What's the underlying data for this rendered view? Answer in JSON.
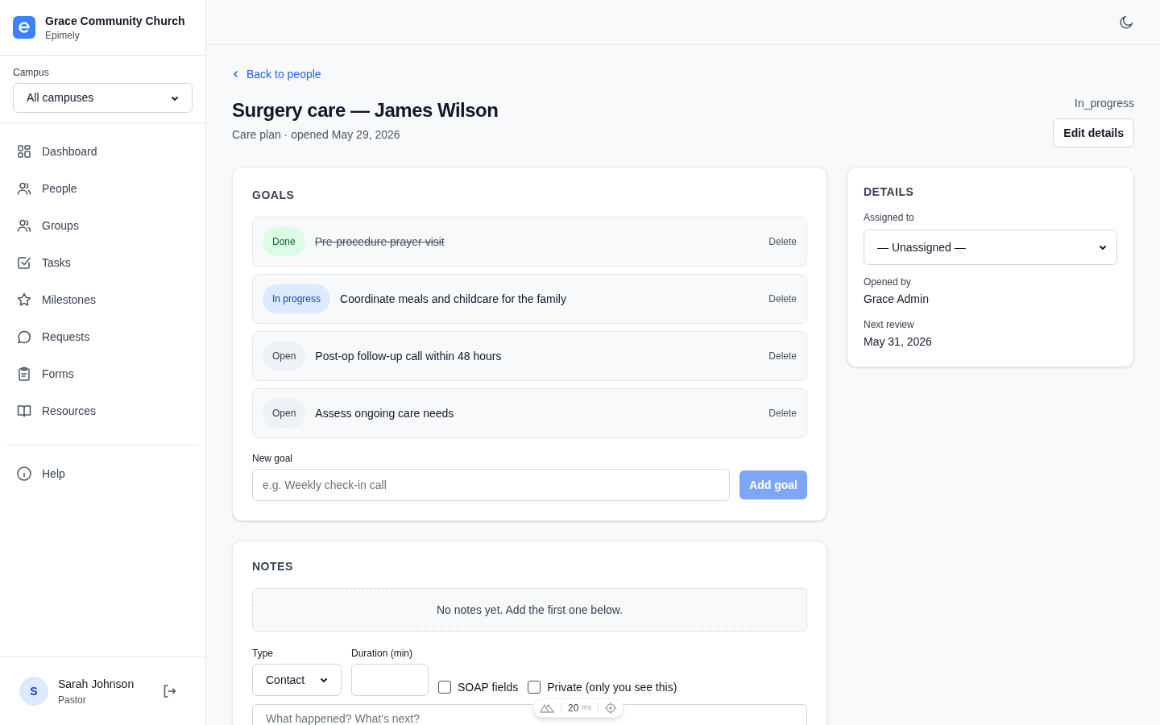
{
  "org": {
    "name": "Grace Community Church",
    "product": "Epimely"
  },
  "campus": {
    "label": "Campus",
    "value": "All campuses"
  },
  "nav": [
    {
      "label": "Dashboard"
    },
    {
      "label": "People"
    },
    {
      "label": "Groups"
    },
    {
      "label": "Tasks"
    },
    {
      "label": "Milestones"
    },
    {
      "label": "Requests"
    },
    {
      "label": "Forms"
    },
    {
      "label": "Resources"
    }
  ],
  "help": {
    "label": "Help"
  },
  "user": {
    "initial": "S",
    "name": "Sarah Johnson",
    "role": "Pastor"
  },
  "back_link": "Back to people",
  "title": "Surgery care — James Wilson",
  "subtitle": "Care plan · opened May 29, 2026",
  "status": "In_progress",
  "edit_button": "Edit details",
  "goals": {
    "heading": "GOALS",
    "items": [
      {
        "kind": "done",
        "badge": "Done",
        "text": "Pre-procedure prayer visit",
        "action": "Delete"
      },
      {
        "kind": "in_progress",
        "badge": "In progress",
        "text": "Coordinate meals and childcare for the family",
        "action": "Delete"
      },
      {
        "kind": "open",
        "badge": "Open",
        "text": "Post-op follow-up call within 48 hours",
        "action": "Delete"
      },
      {
        "kind": "open",
        "badge": "Open",
        "text": "Assess ongoing care needs",
        "action": "Delete"
      }
    ],
    "new_label": "New goal",
    "new_placeholder": "e.g. Weekly check-in call",
    "add_button": "Add goal",
    "add_disabled": true
  },
  "notes": {
    "heading": "NOTES",
    "empty": "No notes yet. Add the first one below.",
    "type_label": "Type",
    "type_value": "Contact",
    "duration_label": "Duration (min)",
    "checkboxes": [
      {
        "label": "SOAP fields",
        "checked": false
      },
      {
        "label": "Private (only you see this)",
        "checked": false
      }
    ],
    "placeholder": "What happened? What's next?"
  },
  "details": {
    "heading": "DETAILS",
    "assigned_label": "Assigned to",
    "assigned_value": "— Unassigned —",
    "opened_label": "Opened by",
    "opened_value": "Grace Admin",
    "review_label": "Next review",
    "review_value": "May 31, 2026"
  },
  "dev_toolbar": {
    "value": "20",
    "unit": "ms"
  }
}
